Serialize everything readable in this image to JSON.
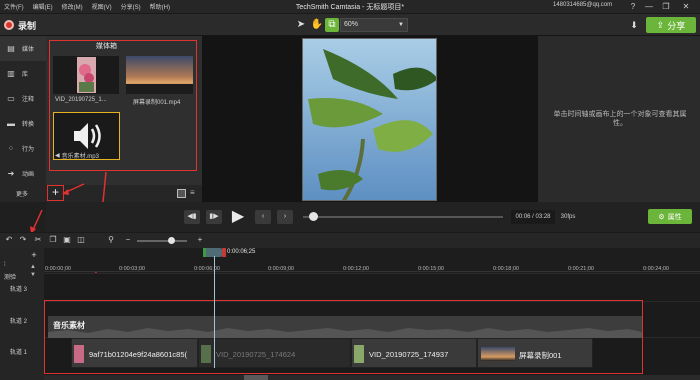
{
  "window": {
    "title": "TechSmith Camtasia - 无标题项目*",
    "menu": [
      "文件(F)",
      "编辑(E)",
      "修改(M)",
      "视图(V)",
      "分享(S)",
      "帮助(H)"
    ],
    "account": "1480314685@qq.com",
    "win_buttons": [
      "?",
      "—",
      "❐",
      "✕"
    ]
  },
  "toolbar": {
    "record_label": "录制",
    "zoom_value": "60%",
    "share_label": "分享"
  },
  "tools": [
    {
      "label": "媒体",
      "icon": "film-icon"
    },
    {
      "label": "库",
      "icon": "library-icon"
    },
    {
      "label": "注释",
      "icon": "annotation-icon"
    },
    {
      "label": "转换",
      "icon": "transition-icon"
    },
    {
      "label": "行为",
      "icon": "behavior-icon"
    },
    {
      "label": "动画",
      "icon": "animation-icon"
    },
    {
      "label": "更多",
      "icon": ""
    }
  ],
  "media_bin": {
    "title": "媒体箱",
    "items": [
      {
        "label": "VID_20190725_1..."
      },
      {
        "label": "屏幕录制001.mp4"
      },
      {
        "label": "音乐素材.mp3"
      }
    ]
  },
  "properties": {
    "hint": "单击时间轴或画布上的一个对象可查看其属性。"
  },
  "playback": {
    "time": "00:06 / 03:28",
    "fps": "30fps",
    "properties_label": "属性"
  },
  "timeline": {
    "playhead_time": "0:00:06;25",
    "ticks": [
      "0:00:00;00",
      "0:00:03;00",
      "0:00:06;00",
      "0:00:09;00",
      "0:00:12;00",
      "0:00:15;00",
      "0:00:18;00",
      "0:00:21;00",
      "0:00:24;00"
    ],
    "tracks": [
      {
        "label": "轨道 3"
      },
      {
        "label": "轨道 2"
      },
      {
        "label": "轨道 1"
      }
    ],
    "markers_label": "测验",
    "audio_clip": "音乐素材",
    "video_clips": [
      {
        "label": "9af71b01204e9f24a8601c85("
      },
      {
        "label": "VID_20190725_174624"
      },
      {
        "label": "VID_20190725_174937"
      },
      {
        "label": "屏幕录制001"
      }
    ]
  }
}
